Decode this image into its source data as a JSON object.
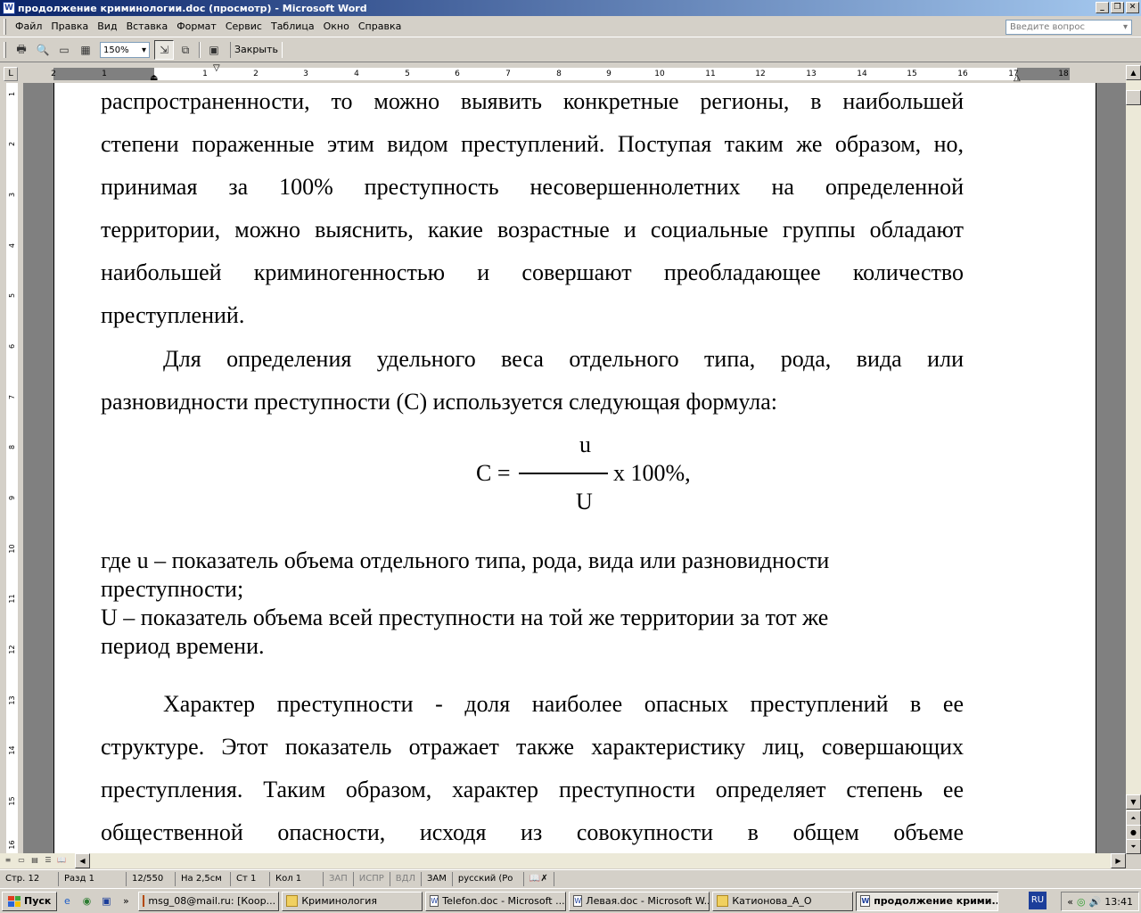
{
  "window": {
    "title": "продолжение криминологии.doc (просмотр) - Microsoft Word"
  },
  "menu": {
    "items": [
      "Файл",
      "Правка",
      "Вид",
      "Вставка",
      "Формат",
      "Сервис",
      "Таблица",
      "Окно",
      "Справка"
    ],
    "ask_placeholder": "Введите вопрос"
  },
  "toolbar": {
    "zoom": "150%",
    "close_label": "Закрыть"
  },
  "document": {
    "para1": [
      "распространенности, то можно выявить конкретные регионы, в наибольшей",
      "степени пораженные этим видом преступлений. Поступая таким же образом, но,",
      "принимая за 100% преступность несовершеннолетних на определенной",
      "территории, можно выяснить, какие возрастные и социальные группы обладают",
      "наибольшей криминогенностью и совершают преобладающее количество",
      "преступлений."
    ],
    "para2": [
      "Для определения удельного веса отдельного типа, рода, вида или",
      "разновидности преступности (С) используется следующая формула:"
    ],
    "formula": {
      "lhs": "С =",
      "numerator": "u",
      "denominator": "U",
      "rhs": "x 100%,"
    },
    "para3": [
      "где u – показатель объема отдельного типа, рода, вида или разновидности",
      "преступности;",
      "U – показатель объема всей преступности на той же территории за тот же",
      "период времени."
    ],
    "para4": [
      "Характер преступности - доля наиболее опасных преступлений в ее",
      "структуре. Этот показатель отражает также характеристику лиц, совершающих",
      "преступления. Таким образом, характер преступности определяет степень ее",
      "общественной опасности, исходя из совокупности в общем объеме"
    ]
  },
  "ruler": {
    "h_left": [
      "2",
      "1"
    ],
    "h_right": [
      "1",
      "2",
      "3",
      "4",
      "5",
      "6",
      "7",
      "8",
      "9",
      "10",
      "11",
      "12",
      "13",
      "14",
      "15",
      "16",
      "17",
      "18"
    ],
    "v": [
      "1",
      "2",
      "3",
      "4",
      "5",
      "6",
      "7",
      "8",
      "9",
      "10",
      "11",
      "12",
      "13",
      "14",
      "15",
      "16"
    ]
  },
  "status": {
    "page": "Стр. 12",
    "section": "Разд 1",
    "pages": "12/550",
    "at": "На 2,5см",
    "line": "Ст 1",
    "col": "Кол 1",
    "rec": "ЗАП",
    "trk": "ИСПР",
    "ext": "ВДЛ",
    "ovr": "ЗАМ",
    "lang": "русский (Ро"
  },
  "taskbar": {
    "start": "Пуск",
    "tasks": [
      {
        "label": "msg_08@mail.ru: [Коор...",
        "active": false
      },
      {
        "label": "Криминология",
        "active": false
      },
      {
        "label": "Telefon.doc - Microsoft ...",
        "active": false
      },
      {
        "label": "Левая.doc - Microsoft W...",
        "active": false
      },
      {
        "label": "Катионова_А_О",
        "active": false
      },
      {
        "label": "продолжение крими...",
        "active": true
      }
    ],
    "lang": "RU",
    "clock": "13:41"
  }
}
